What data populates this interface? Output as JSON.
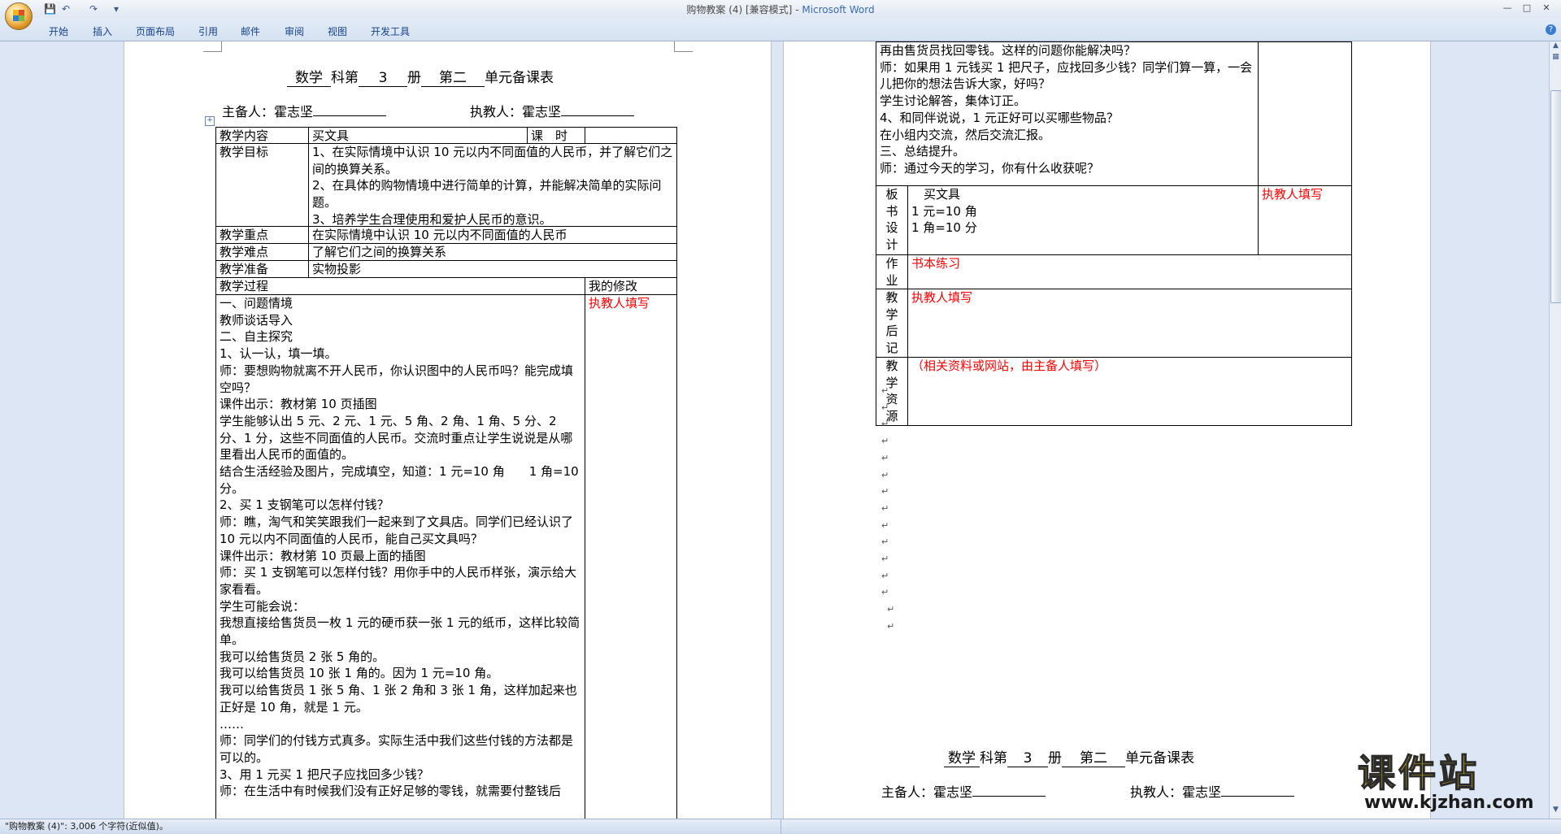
{
  "window": {
    "title_doc": "购物教案 (4) [兼容模式]",
    "title_sep": " - ",
    "title_app": "Microsoft Word",
    "min": "—",
    "max": "□",
    "close": "✕"
  },
  "qat": {
    "save": "💾",
    "undo": "↶",
    "redo": "↷",
    "more": "▾"
  },
  "ribbon": {
    "tabs": [
      "开始",
      "插入",
      "页面布局",
      "引用",
      "邮件",
      "审阅",
      "视图",
      "开发工具"
    ],
    "help": "?"
  },
  "status": {
    "text": "\"购物教案 (4)\": 3,006 个字符(近似值)。"
  },
  "page1": {
    "heading": {
      "subject": "数学",
      "t1": "科第",
      "volume": "3",
      "t2": "册",
      "unit": "第二",
      "t3": "单元备课表"
    },
    "preparer_label": "主备人：霍志坚",
    "executor_label": "执教人：霍志坚",
    "table": {
      "content_label": "教学内容",
      "content_value": "买文具",
      "hours_label": "课　时",
      "goals_label": "教学目标",
      "goals_value": "1、在实际情境中认识 10 元以内不同面值的人民币，并了解它们之间的换算关系。\n2、在具体的购物情境中进行简单的计算，并能解决简单的实际问题。\n3、培养学生合理使用和爱护人民币的意识。",
      "key_label": "教学重点",
      "key_value": "在实际情境中认识 10 元以内不同面值的人民币",
      "difficulty_label": "教学难点",
      "difficulty_value": "了解它们之间的换算关系",
      "prep_label": "教学准备",
      "prep_value": "实物投影",
      "process_label": "教学过程",
      "revision_label": "我的修改",
      "revision_value": "执教人填写",
      "process_text": "一、问题情境\n教师谈话导入\n二、自主探究\n1、认一认，填一填。\n师：要想购物就离不开人民币，你认识图中的人民币吗？能完成填空吗？\n课件出示：教材第 10 页插图\n学生能够认出 5 元、2 元、1 元、5 角、2 角、1 角、5 分、2 分、1 分，这些不同面值的人民币。交流时重点让学生说说是从哪里看出人民币的面值的。\n结合生活经验及图片，完成填空，知道：1 元=10 角　　1 角=10 分。\n2、买 1 支钢笔可以怎样付钱？\n师：瞧，淘气和笑笑跟我们一起来到了文具店。同学们已经认识了 10 元以内不同面值的人民币，能自己买文具吗？\n课件出示：教材第 10 页最上面的插图\n师：买 1 支钢笔可以怎样付钱？用你手中的人民币样张，演示给大家看看。\n学生可能会说：\n我想直接给售货员一枚 1 元的硬币获一张 1 元的纸币，这样比较简单。\n我可以给售货员 2 张 5 角的。\n我可以给售货员 10 张 1 角的。因为 1 元=10 角。\n我可以给售货员 1 张 5 角、1 张 2 角和 3 张 1 角，这样加起来也正好是 10 角，就是 1 元。\n……\n师：同学们的付钱方式真多。实际生活中我们这些付钱的方法都是可以的。\n3、用 1 元买 1 把尺子应找回多少钱？\n师：在生活中有时候我们没有正好足够的零钱，就需要付整钱后"
    }
  },
  "page2": {
    "table": {
      "cont_text": "再由售货员找回零钱。这样的问题你能解决吗？\n师：如果用 1 元钱买 1 把尺子，应找回多少钱？同学们算一算，一会儿把你的想法告诉大家，好吗？\n学生讨论解答，集体订正。\n4、和同伴说说，1 元正好可以买哪些物品？\n在小组内交流，然后交流汇报。\n三、总结提升。\n师：通过今天的学习，你有什么收获呢？",
      "board_label": "板\n书\n设\n计",
      "board_value": "　买文具\n1 元=10 角\n1 角=10 分",
      "board_note": "执教人填写",
      "homework_label": "作\n业",
      "homework_value": "书本练习",
      "reflection_label": "教\n学\n后\n记",
      "reflection_value": "执教人填写",
      "resources_label": "教\n学\n资\n源",
      "resources_value": "（相关资料或网站，由主备人填写）"
    },
    "heading": {
      "subject": "数学",
      "t1": "科第",
      "volume": "3",
      "t2": "册",
      "unit": "第二",
      "t3": "单元备课表"
    },
    "preparer_label": "主备人：霍志坚",
    "executor_label": "执教人：霍志坚"
  },
  "watermark": {
    "name": "课件站",
    "url": "www.kjzhan.com"
  }
}
